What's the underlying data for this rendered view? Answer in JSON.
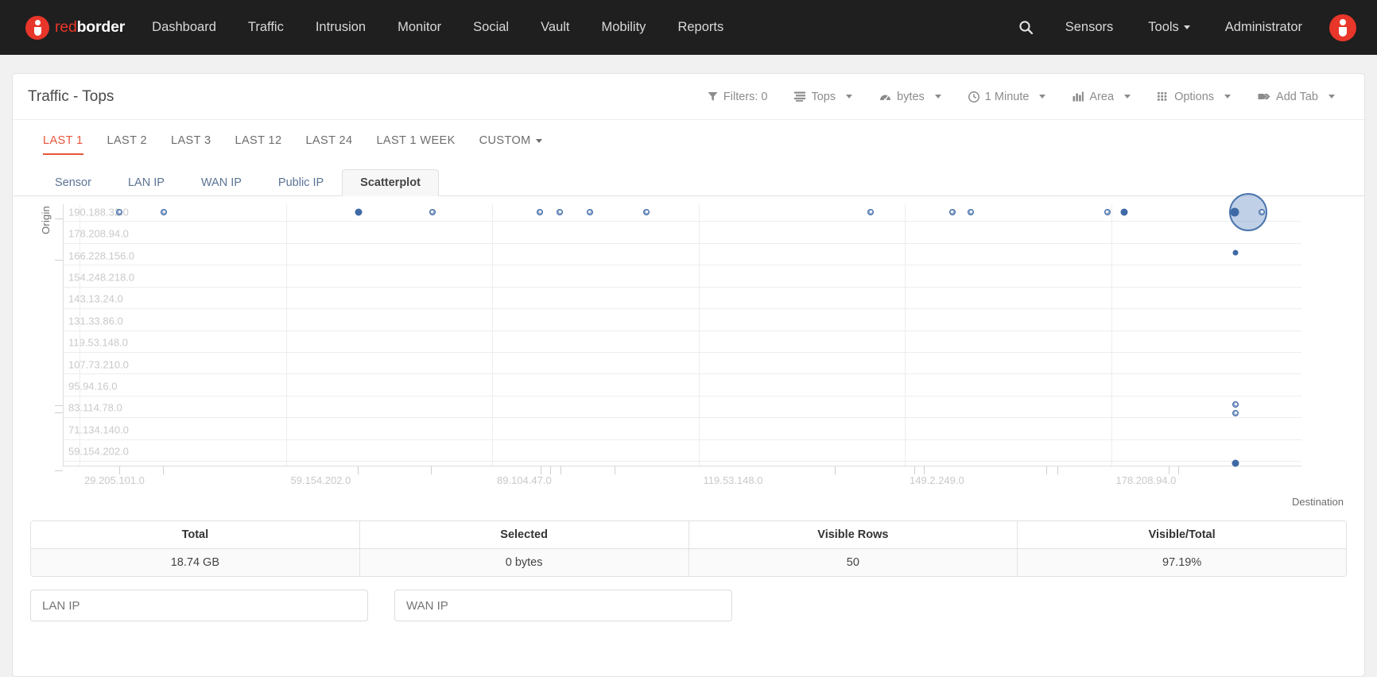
{
  "navbar": {
    "brand": {
      "first": "red",
      "second": "border",
      "logo_icon": "redborder-logo-icon"
    },
    "links": [
      "Dashboard",
      "Traffic",
      "Intrusion",
      "Monitor",
      "Social",
      "Vault",
      "Mobility",
      "Reports"
    ],
    "right": {
      "search_icon": "search-icon",
      "sensors": "Sensors",
      "tools": "Tools",
      "administrator": "Administrator",
      "avatar_icon": "user-avatar-icon"
    }
  },
  "panel": {
    "title": "Traffic - Tops",
    "toolbar": [
      {
        "label": "Filters: 0",
        "icon": "filter-icon",
        "caret": false
      },
      {
        "label": "Tops",
        "icon": "list-icon",
        "caret": true
      },
      {
        "label": "bytes",
        "icon": "gauge-icon",
        "caret": true
      },
      {
        "label": "1 Minute",
        "icon": "clock-icon",
        "caret": true
      },
      {
        "label": "Area",
        "icon": "bar-chart-icon",
        "caret": true
      },
      {
        "label": "Options",
        "icon": "grid-icon",
        "caret": true
      },
      {
        "label": "Add Tab",
        "icon": "tag-icon",
        "caret": true
      }
    ]
  },
  "time_tabs": {
    "items": [
      "LAST 1",
      "LAST 2",
      "LAST 3",
      "LAST 12",
      "LAST 24",
      "LAST 1 WEEK"
    ],
    "active": "LAST 1",
    "custom": "CUSTOM"
  },
  "sub_tabs": {
    "items": [
      "Sensor",
      "LAN IP",
      "WAN IP",
      "Public IP",
      "Scatterplot"
    ],
    "active": "Scatterplot"
  },
  "chart_data": {
    "type": "scatter",
    "title": "",
    "xlabel": "Destination",
    "ylabel": "Origin",
    "grid": true,
    "legend": "none",
    "ytick_labels": [
      "190.188.32.0",
      "178.208.94.0",
      "166.228.156.0",
      "154.248.218.0",
      "143.13.24.0",
      "131.33.86.0",
      "119.53.148.0",
      "107.73.210.0",
      "95.94.16.0",
      "83.114.78.0",
      "71.134.140.0",
      "59.154.202.0"
    ],
    "xtick_labels": [
      "29.205.101.0",
      "59.154.202.0",
      "89.104.47.0",
      "119.53.148.0",
      "149.2.249.0",
      "178.208.94.0"
    ],
    "xlim": [
      "0.0.0.0",
      "208.0.0.0"
    ],
    "ylim": [
      "59.154.202.0",
      "196.0.0.0"
    ],
    "points": [
      {
        "xp": 4.5,
        "yp": 3.0,
        "r": 4.0,
        "style": "hollow"
      },
      {
        "xp": 8.1,
        "yp": 3.0,
        "r": 4.0,
        "style": "hollow"
      },
      {
        "xp": 23.8,
        "yp": 3.0,
        "r": 4.5,
        "style": "solid"
      },
      {
        "xp": 29.8,
        "yp": 3.0,
        "r": 4.0,
        "style": "hollow"
      },
      {
        "xp": 38.5,
        "yp": 3.0,
        "r": 4.0,
        "style": "hollow"
      },
      {
        "xp": 40.1,
        "yp": 3.0,
        "r": 4.0,
        "style": "hollow"
      },
      {
        "xp": 42.5,
        "yp": 3.0,
        "r": 4.0,
        "style": "hollow"
      },
      {
        "xp": 47.1,
        "yp": 3.0,
        "r": 4.0,
        "style": "hollow"
      },
      {
        "xp": 65.2,
        "yp": 3.0,
        "r": 4.0,
        "style": "hollow"
      },
      {
        "xp": 71.8,
        "yp": 3.0,
        "r": 4.0,
        "style": "hollow"
      },
      {
        "xp": 73.3,
        "yp": 3.0,
        "r": 4.0,
        "style": "hollow"
      },
      {
        "xp": 84.3,
        "yp": 3.0,
        "r": 4.0,
        "style": "hollow"
      },
      {
        "xp": 85.7,
        "yp": 3.0,
        "r": 4.5,
        "style": "solid"
      },
      {
        "xp": 94.6,
        "yp": 3.0,
        "r": 5.5,
        "style": "solid"
      },
      {
        "xp": 96.8,
        "yp": 3.0,
        "r": 4.0,
        "style": "hollow"
      },
      {
        "xp": 94.7,
        "yp": 18.5,
        "r": 3.5,
        "style": "solid"
      },
      {
        "xp": 94.7,
        "yp": 76.5,
        "r": 4.0,
        "style": "hollow"
      },
      {
        "xp": 94.7,
        "yp": 79.8,
        "r": 4.0,
        "style": "hollow"
      },
      {
        "xp": 94.7,
        "yp": 99.2,
        "r": 4.5,
        "style": "solid"
      }
    ],
    "cluster": {
      "xp": 95.7,
      "yp": 3.0,
      "r": 24
    }
  },
  "stats": {
    "headers": [
      "Total",
      "Selected",
      "Visible Rows",
      "Visible/Total"
    ],
    "values": [
      "18.74 GB",
      "0 bytes",
      "50",
      "97.19%"
    ]
  },
  "filters": {
    "lan_ip_placeholder": "LAN IP",
    "lan_ip_value": "",
    "wan_ip_placeholder": "WAN IP",
    "wan_ip_value": ""
  },
  "colors": {
    "accent": "#e8362a",
    "active_tab": "#e8553c",
    "point": "#3f6aa5",
    "navbar_bg": "#1f1f1f"
  }
}
